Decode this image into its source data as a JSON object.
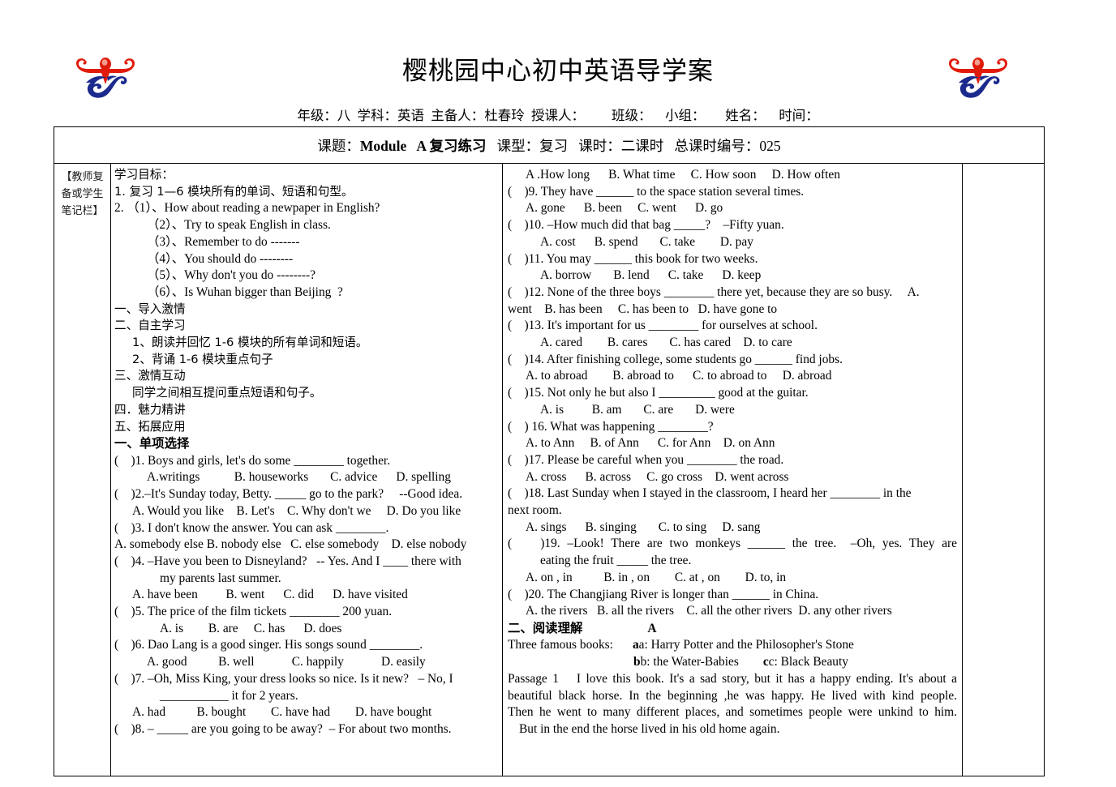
{
  "header": {
    "title": "樱桃园中心初中英语导学案",
    "meta": "年级：八  学科：英语  主备人：杜春玲  授课人：        班级：    小组：      姓名：    时间：",
    "logo_name": "school-emblem",
    "logo_colors": {
      "red": "#e01b0c",
      "blue": "#1b2a8c"
    }
  },
  "topic_row": {
    "prefix": "课题：",
    "module": "Module   A 复习练习",
    "rest": "   课型：复习   课时：二课时   总课时编号：025"
  },
  "notes_column": {
    "label": "【教师复备或学生笔记栏】"
  },
  "left_column": {
    "objectives_heading": "学习目标：",
    "objective_1": "1. 复习 1—6 模块所有的单词、短语和句型。",
    "objective_2": "2. （1）、How about reading a newpaper in English?",
    "objective_sub": [
      "（2）、Try to speak English in class.",
      "（3）、Remember to do -------",
      "（4）、You should do --------",
      "（5）、Why don't you do --------?",
      "（6）、Is Wuhan bigger than Beijing  ?"
    ],
    "sections": [
      "一、导入激情",
      "二、自主学习"
    ],
    "sub_items": [
      "1、朗读并回忆 1-6 模块的所有单词和短语。",
      "2、背诵 1-6 模块重点句子"
    ],
    "section3": "三、激情互动",
    "section3_text": "同学之间相互提问重点短语和句子。",
    "section4": "四．魅力精讲",
    "section5": "五、拓展应用",
    "part1_heading": "一、单项选择",
    "questions": [
      {
        "stem": "(    )1. Boys and girls, let's do some ________ together.",
        "options": "A.writings           B. houseworks       C. advice      D. spelling",
        "options_indent": "ind2"
      },
      {
        "stem": "(    )2.–It's Sunday today, Betty. _____ go to the park?     --Good idea.",
        "options": "A. Would you like    B. Let's    C. Why don't we     D. Do you like",
        "options_indent": "ind1"
      },
      {
        "stem": "(    )3. I don't know the answer. You can ask ________.",
        "options": "A. somebody else B. nobody else   C. else somebody    D. else nobody",
        "options_indent": ""
      },
      {
        "stem": "(    )4. –Have you been to Disneyland?   -- Yes. And I ____ there with",
        "stem_cont": "my parents last summer.",
        "options": "A. have been         B. went      C. did      D. have visited",
        "options_indent": "ind1"
      },
      {
        "stem": "(    )5. The price of the film tickets ________ 200 yuan.",
        "options": "A. is        B. are     C. has      D. does",
        "options_indent": "ind3"
      },
      {
        "stem": "(    )6. Dao Lang is a good singer. His songs sound ________.",
        "options": "A. good          B. well            C. happily            D. easily",
        "options_indent": "ind2"
      },
      {
        "stem": "(    )7. –Oh, Miss King, your dress looks so nice. Is it new?   – No, I",
        "stem_cont": "___________ it for 2 years.",
        "options": "A. had          B. bought        C. have had        D. have bought",
        "options_indent": "ind1"
      },
      {
        "stem": "(    )8. – _____ are you going to be away?  – For about two months.",
        "options": "",
        "options_indent": ""
      }
    ]
  },
  "right_column": {
    "q8_options": "A .How long      B. What time     C. How soon     D. How often",
    "questions": [
      {
        "stem": "(    )9. They have ______ to the space station several times.",
        "options": "A. gone      B. been     C. went      D. go",
        "options_indent": "ind1"
      },
      {
        "stem": "(    )10. –How much did that bag _____?    –Fifty yuan.",
        "options": "A. cost      B. spend       C. take        D. pay",
        "options_indent": "ind2"
      },
      {
        "stem": "(    )11. You may ______ this book for two weeks.",
        "options": "A. borrow       B. lend      C. take      D. keep",
        "options_indent": "ind2"
      },
      {
        "stem": "(    )12. None of the three boys ________ there yet, because they are so busy.     A.",
        "options": "went    B. has been     C. has been to   D. have gone to",
        "options_indent": ""
      },
      {
        "stem": "(    )13. It's important for us ________ for ourselves at school.",
        "options": "A. cared        B. cares       C. has cared    D. to care",
        "options_indent": "ind2"
      },
      {
        "stem": "(    )14. After finishing college, some students go ______ find jobs.",
        "options": "A. to abroad        B. abroad to      C. to abroad to     D. abroad",
        "options_indent": "ind1"
      },
      {
        "stem": "(    )15. Not only he but also I _________ good at the guitar.",
        "options": "A. is         B. am       C. are       D. were",
        "options_indent": "ind2"
      },
      {
        "stem": "(    ) 16. What was happening ________?",
        "options": "A. to Ann     B. of Ann      C. for Ann    D. on Ann",
        "options_indent": "ind1"
      },
      {
        "stem": "(    )17. Please be careful when you ________ the road.",
        "options": "A. cross      B. across     C. go cross    D. went across",
        "options_indent": "ind1"
      },
      {
        "stem": "(    )18. Last Sunday when I stayed in the classroom, I heard her ________ in the",
        "stem_cont": "next room.",
        "options": "A. sings      B. singing       C. to sing     D. sang",
        "options_indent": "ind1"
      },
      {
        "stem": "(    )19. –Look! There are two monkeys ______ the tree.  –Oh, yes. They are",
        "stem_cont": "eating the fruit _____ the tree.",
        "options": "A. on , in          B. in , on        C. at , on        D. to, in",
        "options_indent": "ind1"
      },
      {
        "stem": "(    )20. The Changjiang River is longer than ______ in China.",
        "options": "A. the rivers   B. all the rivers    C. all the other rivers  D. any other rivers",
        "options_indent": "ind1"
      }
    ],
    "part2_heading": "二、阅读理解",
    "part2_label": "A",
    "books_intro": "Three famous books:",
    "book_a": "a: Harry Potter and the Philosopher's Stone",
    "book_b": "b: the Water-Babies",
    "book_c": "c: Black Beauty",
    "passage_label": "Passage 1",
    "passage_lines": [
      "I love this book. It's a sad story, but it has a happy ending. It's about a",
      "beautiful black horse. In the beginning ,he was happy. He lived with kind people.",
      "Then he went to many different places, and sometimes people were unkind to him.",
      "But in the end the horse lived in his old home again."
    ]
  }
}
